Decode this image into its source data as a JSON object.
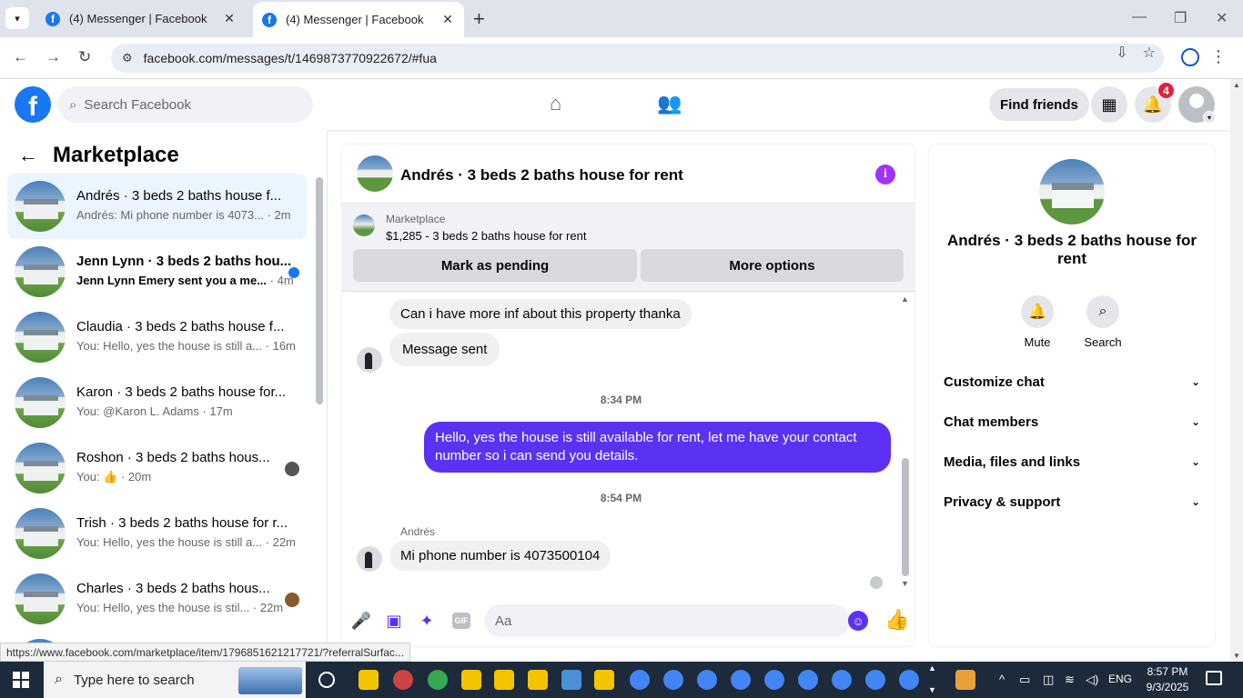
{
  "browser": {
    "tabs": [
      {
        "title": "(4) Messenger | Facebook",
        "active": false
      },
      {
        "title": "(4) Messenger | Facebook",
        "active": true
      }
    ],
    "url": "facebook.com/messages/t/1469873770922672/#fua",
    "status_url": "https://www.facebook.com/marketplace/item/1796851621217721/?referralSurfac..."
  },
  "header": {
    "search_placeholder": "Search Facebook",
    "find_friends_label": "Find friends",
    "notification_count": "4"
  },
  "sidebar": {
    "title": "Marketplace",
    "chats": [
      {
        "name": "Andrés · 3 beds 2 baths house f...",
        "preview": "Andrés: Mi phone number is 4073...",
        "time": " · 2m",
        "active": true,
        "unread": false,
        "indicator": "none"
      },
      {
        "name": "Jenn Lynn · 3 beds 2 baths hou...",
        "preview": "Jenn Lynn Emery sent you a me...",
        "time": " · 4m",
        "active": false,
        "unread": true,
        "indicator": "dot"
      },
      {
        "name": "Claudia · 3 beds 2 baths house f...",
        "preview": "You: Hello, yes the house is still a...",
        "time": " · 16m",
        "active": false,
        "unread": false,
        "indicator": "none"
      },
      {
        "name": "Karon · 3 beds 2 baths house for...",
        "preview": "You: @Karon L. Adams",
        "time": " · 17m",
        "active": false,
        "unread": false,
        "indicator": "none"
      },
      {
        "name": "Roshon · 3 beds 2 baths hous...",
        "preview": "You: 👍",
        "time": " · 20m",
        "active": false,
        "unread": false,
        "indicator": "avatar"
      },
      {
        "name": "Trish · 3 beds 2 baths house for r...",
        "preview": "You: Hello, yes the house is still a...",
        "time": " · 22m",
        "active": false,
        "unread": false,
        "indicator": "none"
      },
      {
        "name": "Charles · 3 beds 2 baths hous...",
        "preview": "You: Hello, yes the house is stil...",
        "time": " · 22m",
        "active": false,
        "unread": false,
        "indicator": "avatar"
      }
    ]
  },
  "chat": {
    "title": "Andrés · 3 beds 2 baths house for rent",
    "marketplace_label": "Marketplace",
    "listing": "$1,285 - 3 beds 2 baths house for rent",
    "mark_pending_label": "Mark as pending",
    "more_options_label": "More options",
    "messages": {
      "m1": "Can i have more inf about this property thanka",
      "m2": "Message sent",
      "ts1": "8:34 PM",
      "m3": "Hello, yes the house is still available for rent, let me have your contact number so i can send you details.",
      "ts2": "8:54 PM",
      "sender": "Andrés",
      "m4": "Mi phone number is 4073500104"
    },
    "composer_placeholder": "Aa"
  },
  "info_panel": {
    "name": "Andrés · 3 beds 2 baths house for rent",
    "mute_label": "Mute",
    "search_label": "Search",
    "rows": [
      "Customize chat",
      "Chat members",
      "Media, files and links",
      "Privacy & support"
    ]
  },
  "taskbar": {
    "search_placeholder": "Type here to search",
    "language": "ENG",
    "time": "8:57 PM",
    "date": "9/3/2025"
  },
  "colors": {
    "accent": "#5b31f4",
    "facebook_blue": "#1877f2",
    "badge_red": "#e41e3f",
    "info_purple": "#a033ff"
  }
}
